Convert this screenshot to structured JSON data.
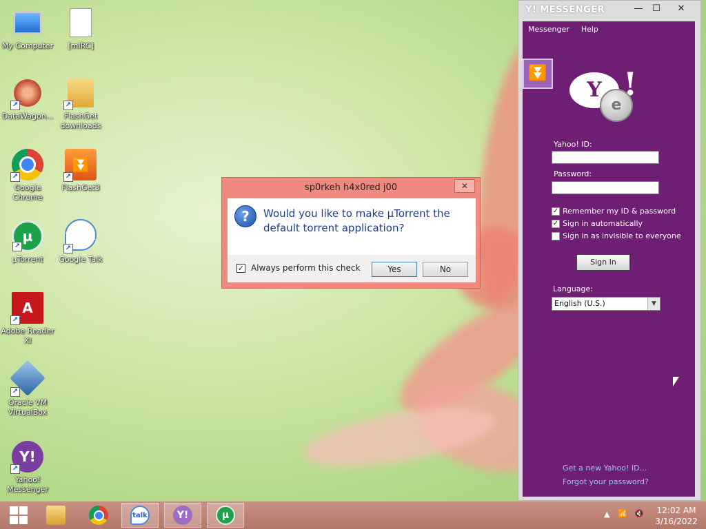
{
  "desktop": {
    "icons": [
      {
        "label": "My Computer",
        "icon": "computer-icon"
      },
      {
        "label": "[mIRC]",
        "icon": "document-icon"
      },
      {
        "label": "DataWagon...",
        "icon": "datawagon-icon"
      },
      {
        "label": "FlashGet downloads",
        "icon": "folder-icon"
      },
      {
        "label": "Google Chrome",
        "icon": "chrome-icon"
      },
      {
        "label": "FlashGet3",
        "icon": "flashget-icon"
      },
      {
        "label": "µTorrent",
        "icon": "utorrent-icon"
      },
      {
        "label": "Google Talk",
        "icon": "google-talk-icon"
      },
      {
        "label": "Adobe Reader XI",
        "icon": "adobe-reader-icon"
      },
      {
        "label": "Oracle VM VirtualBox",
        "icon": "virtualbox-icon"
      },
      {
        "label": "Yahoo! Messenger",
        "icon": "yahoo-messenger-icon"
      }
    ]
  },
  "dialog": {
    "title": "sp0rkeh h4x0red j00",
    "close_glyph": "✕",
    "question_glyph": "?",
    "message": "Would you like to make µTorrent the default torrent application?",
    "checkbox_label": "Always perform this check",
    "checkbox_checked": true,
    "check_glyph": "✓",
    "yes_label": "Yes",
    "no_label": "No"
  },
  "messenger": {
    "brand": "Y! MESSENGER",
    "window_buttons": {
      "minimize": "—",
      "maximize": "☐",
      "close": "✕"
    },
    "menu": [
      "Messenger",
      "Help"
    ],
    "logo_text": "Y",
    "logo_excl": "!",
    "coin_glyph": "e",
    "collapse_glyph": "⏬",
    "yahoo_id_label": "Yahoo! ID:",
    "yahoo_id_value": "",
    "password_label": "Password:",
    "password_value": "",
    "options": [
      {
        "label": "Remember my ID & password",
        "checked": true
      },
      {
        "label": "Sign in automatically",
        "checked": true
      },
      {
        "label": "Sign in as invisible to everyone",
        "checked": false
      }
    ],
    "sign_in_label": "Sign In",
    "language_label": "Language:",
    "language_value": "English (U.S.)",
    "dropdown_glyph": "▼",
    "link_new_id": "Get a new Yahoo! ID...",
    "link_forgot": "Forgot your password?"
  },
  "taskbar": {
    "items": [
      {
        "icon": "windows-start-icon",
        "active": false
      },
      {
        "icon": "file-explorer-icon",
        "active": false
      },
      {
        "icon": "chrome-icon",
        "active": false
      },
      {
        "icon": "google-talk-icon",
        "active": true,
        "text": "talk"
      },
      {
        "icon": "yahoo-messenger-icon",
        "active": true,
        "text": "Y!"
      },
      {
        "icon": "utorrent-icon",
        "active": true,
        "text": "µ"
      }
    ],
    "tray": {
      "show_hidden": "▲",
      "network": "📶",
      "volume": "🔇"
    },
    "time": "12:02 AM",
    "date": "3/16/2022"
  }
}
